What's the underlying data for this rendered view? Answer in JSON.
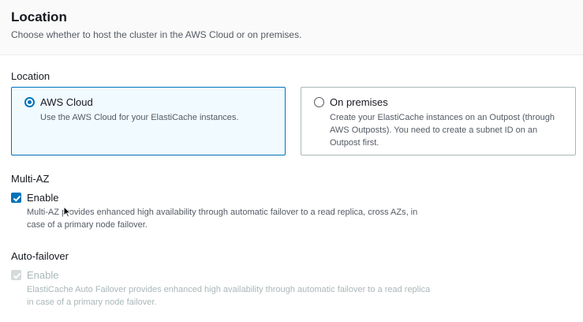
{
  "header": {
    "title": "Location",
    "description": "Choose whether to host the cluster in the AWS Cloud or on premises."
  },
  "location": {
    "label": "Location",
    "options": [
      {
        "title": "AWS Cloud",
        "description": "Use the AWS Cloud for your ElastiCache instances.",
        "selected": true
      },
      {
        "title": "On premises",
        "description": "Create your ElastiCache instances on an Outpost (through AWS Outposts). You need to create a subnet ID on an Outpost first.",
        "selected": false
      }
    ]
  },
  "multi_az": {
    "label": "Multi-AZ",
    "checkbox_label": "Enable",
    "checked": true,
    "description": "Multi-AZ provides enhanced high availability through automatic failover to a read replica, cross AZs, in case of a primary node failover."
  },
  "auto_failover": {
    "label": "Auto-failover",
    "checkbox_label": "Enable",
    "checked": true,
    "disabled": true,
    "description": "ElastiCache Auto Failover provides enhanced high availability through automatic failover to a read replica in case of a primary node failover."
  },
  "colors": {
    "accent": "#0073bb",
    "selected_bg": "#f1faff",
    "disabled": "#aab7b8"
  }
}
